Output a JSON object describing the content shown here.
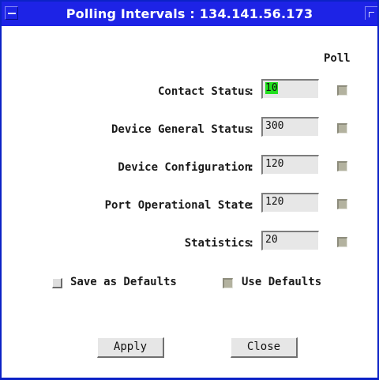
{
  "window": {
    "title": "Polling Intervals : 134.141.56.173"
  },
  "table": {
    "poll_header": "Poll",
    "rows": [
      {
        "label": "Contact Status",
        "separator": ":",
        "value": "10",
        "poll": true
      },
      {
        "label": "Device General Status",
        "separator": ":",
        "value": "300",
        "poll": true
      },
      {
        "label": "Device Configuration",
        "separator": ":",
        "value": "120",
        "poll": true
      },
      {
        "label": "Port Operational State",
        "separator": ":",
        "value": "120",
        "poll": true
      },
      {
        "label": "Statistics",
        "separator": ":",
        "value": "20",
        "poll": true
      }
    ]
  },
  "options": {
    "save_defaults_label": "Save as Defaults",
    "save_defaults_checked": false,
    "use_defaults_label": "Use Defaults",
    "use_defaults_checked": true
  },
  "buttons": {
    "apply_label": "Apply",
    "close_label": "Close"
  },
  "colors": {
    "titlebar": "#1d23e6",
    "selection_highlight": "#22e01f"
  },
  "icons": {
    "window_menu": "window-menu-icon",
    "maximize": "maximize-icon"
  }
}
